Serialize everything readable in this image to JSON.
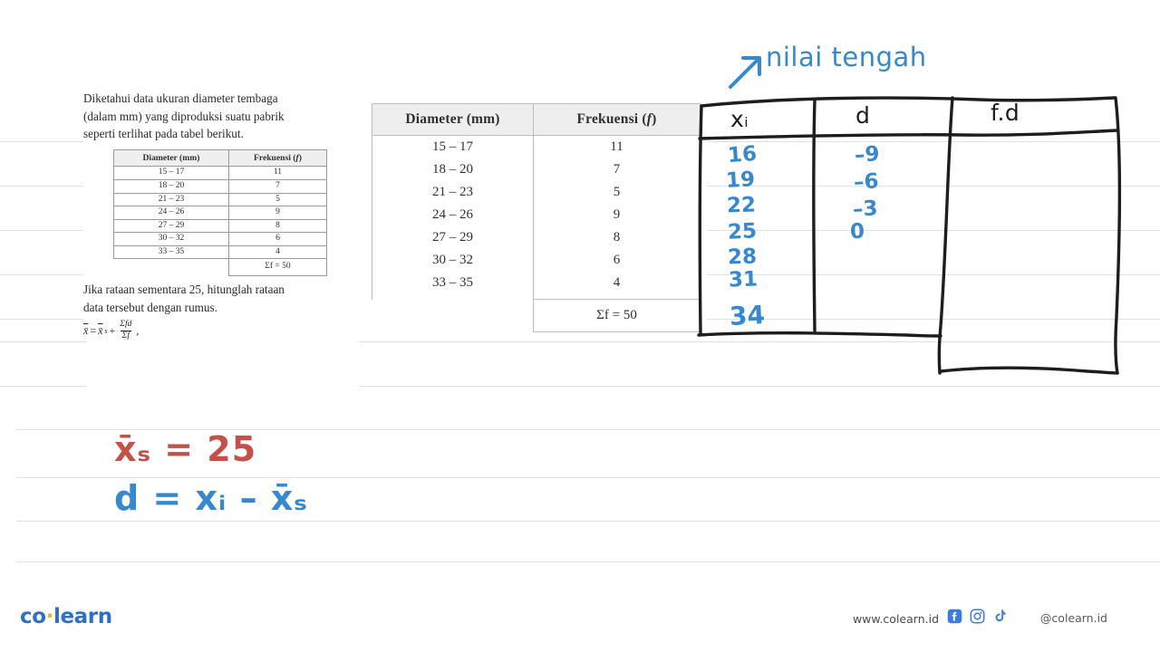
{
  "page": {
    "background": "#ffffff",
    "rule_color": "#e2e2e2",
    "ink_blue": "#3689cf",
    "ink_red": "#c4504a",
    "ink_black": "#1d1d1d"
  },
  "problem": {
    "line1": "Diketahui data ukuran diameter tembaga",
    "line2": "(dalam mm) yang diproduksi suatu pabrik",
    "line3": "seperti terlihat pada tabel berikut.",
    "question_line1": "Jika rataan sementara 25, hitunglah rataan",
    "question_line2": "data tersebut dengan rumus.",
    "formula": {
      "lhs": "x̄",
      "eq": "=",
      "term1": "x̄",
      "term1_sub": "s",
      "plus": "+",
      "numerator": "Σfd",
      "denominator": "Σf",
      "trailing": ","
    }
  },
  "table": {
    "headers": [
      "Diameter (mm)",
      "Frekuensi (f)"
    ],
    "header_italic_symbol": "f",
    "rows": [
      {
        "interval": "15 – 17",
        "frequency": "11"
      },
      {
        "interval": "18 – 20",
        "frequency": "7"
      },
      {
        "interval": "21 – 23",
        "frequency": "5"
      },
      {
        "interval": "24 – 26",
        "frequency": "9"
      },
      {
        "interval": "27 – 29",
        "frequency": "8"
      },
      {
        "interval": "30 – 32",
        "frequency": "6"
      },
      {
        "interval": "33 – 35",
        "frequency": "4"
      }
    ],
    "sum_label": "Σf = 50"
  },
  "annotation": {
    "note_label": "nilai tengah",
    "note_arrow": "↗",
    "hand_table_headers": [
      "xᵢ",
      "d",
      "f.d"
    ],
    "xi_values": [
      "16",
      "19",
      "22",
      "25",
      "28",
      "31",
      "34"
    ],
    "d_values": [
      "–9",
      "–6",
      "–3",
      "0"
    ],
    "fd_values": [],
    "work_line1": "x̄ₛ = 25",
    "work_line2": "d =  xᵢ – x̄ₛ"
  },
  "footer": {
    "logo_pre": "co",
    "logo_dot": "·",
    "logo_post": "learn",
    "website": "www.colearn.id",
    "handle": "@colearn.id",
    "social_icons": [
      "facebook-icon",
      "instagram-icon",
      "tiktok-icon"
    ]
  },
  "chart_data": {
    "type": "table",
    "title": "Diameter (mm) vs Frekuensi (f)",
    "categories": [
      "15 – 17",
      "18 – 20",
      "21 – 23",
      "24 – 26",
      "27 – 29",
      "30 – 32",
      "33 – 35"
    ],
    "values": [
      11,
      7,
      5,
      9,
      8,
      6,
      4
    ],
    "total": 50,
    "xlabel": "Diameter (mm)",
    "ylabel": "Frekuensi (f)",
    "annotated_midpoints": [
      16,
      19,
      22,
      25,
      28,
      31,
      34
    ],
    "annotated_deviations": [
      -9,
      -6,
      -3,
      0
    ],
    "assumed_mean": 25
  }
}
